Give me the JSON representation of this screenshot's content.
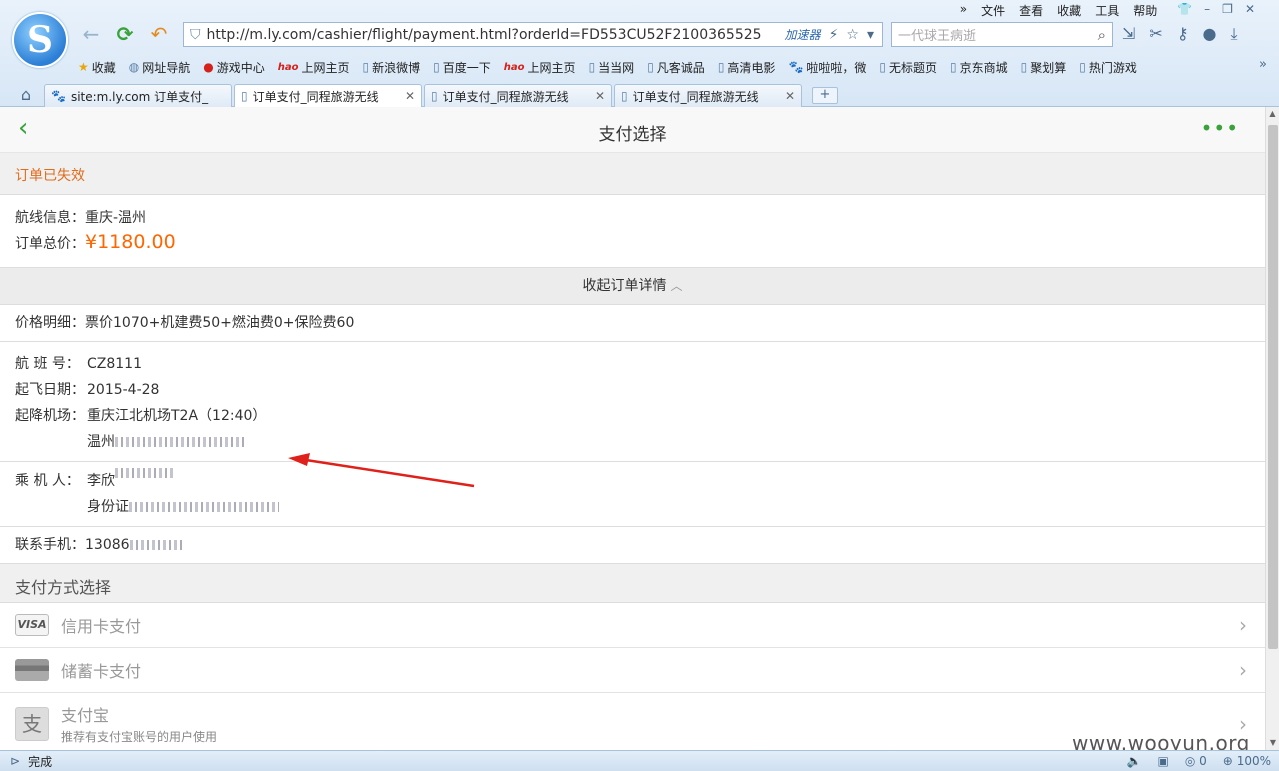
{
  "browser": {
    "logo_letter": "S",
    "menu": [
      "文件",
      "查看",
      "收藏",
      "工具",
      "帮助"
    ],
    "address_url": "http://m.ly.com/cashier/flight/payment.html?orderId=FD553CU52F2100365525",
    "accelerator_label": "加速器",
    "search_placeholder": "一代球王病逝",
    "bookmarks": [
      {
        "label": "收藏",
        "icon": "star-icon"
      },
      {
        "label": "网址导航",
        "icon": "globe-icon"
      },
      {
        "label": "游戏中心",
        "icon": "sogou-icon"
      },
      {
        "label": "上网主页",
        "icon": "hao-icon"
      },
      {
        "label": "新浪微博",
        "icon": "page-icon"
      },
      {
        "label": "百度一下",
        "icon": "page-icon"
      },
      {
        "label": "上网主页",
        "icon": "hao-icon"
      },
      {
        "label": "当当网",
        "icon": "page-icon"
      },
      {
        "label": "凡客诚品",
        "icon": "page-icon"
      },
      {
        "label": "高清电影",
        "icon": "page-icon"
      },
      {
        "label": "啦啦啦，微",
        "icon": "baidu-icon"
      },
      {
        "label": "无标题页",
        "icon": "page-icon"
      },
      {
        "label": "京东商城",
        "icon": "page-icon"
      },
      {
        "label": "聚划算",
        "icon": "page-icon"
      },
      {
        "label": "热门游戏",
        "icon": "page-icon"
      }
    ],
    "tabs": [
      {
        "label": "site:m.ly.com 订单支付_",
        "icon": "baidu-icon"
      },
      {
        "label": "订单支付_同程旅游无线",
        "icon": "page-icon"
      },
      {
        "label": "订单支付_同程旅游无线",
        "icon": "page-icon"
      },
      {
        "label": "订单支付_同程旅游无线",
        "icon": "page-icon"
      }
    ],
    "new_tab": "+",
    "status_text": "完成",
    "status_counter": "0",
    "zoom": "100%"
  },
  "page": {
    "title": "支付选择",
    "order_status": "订单已失效",
    "route_label": "航线信息：",
    "route_value": "重庆-温州",
    "total_label": "订单总价：",
    "total_value": "¥1180.00",
    "collapse_label": "收起订单详情",
    "price_label": "价格明细：",
    "price_value": "票价1070+机建费50+燃油费0+保险费60",
    "flight_no_label": "航 班 号：",
    "flight_no_value": "CZ8111",
    "date_label": "起飞日期：",
    "date_value": "2015-4-28",
    "airport_label": "起降机场：",
    "depart_airport": "重庆江北机场T2A（12:40）",
    "arrive_prefix": "温州",
    "passenger_label": "乘 机 人：",
    "passenger_prefix": "李欣",
    "id_prefix": "身份证",
    "phone_label": "联系手机：",
    "phone_prefix": "13086",
    "pay_section": "支付方式选择",
    "pay_methods": [
      {
        "label": "信用卡支付",
        "icon": "visa-card-icon"
      },
      {
        "label": "储蓄卡支付",
        "icon": "debit-card-icon"
      },
      {
        "label": "支付宝",
        "sub": "推荐有支付宝账号的用户使用",
        "icon": "alipay-icon"
      }
    ],
    "visa_text": "VISA",
    "alipay_glyph": "支"
  },
  "watermark": "www.wooyun.org",
  "colors": {
    "accent_green": "#3aa23a",
    "price_orange": "#ff6600",
    "status_orange": "#e06c1d",
    "annotation_red": "#e0201a"
  }
}
